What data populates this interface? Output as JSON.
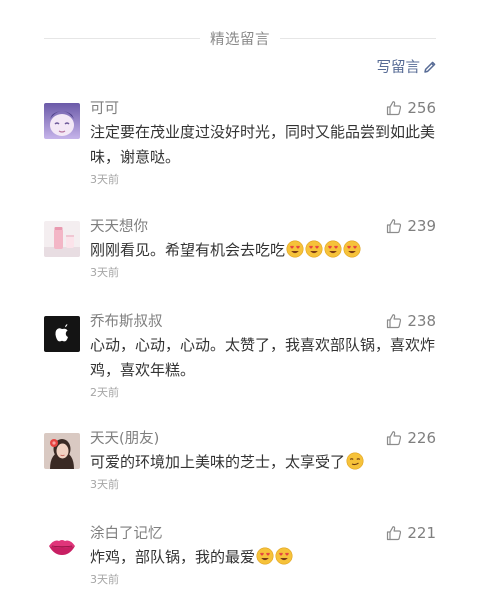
{
  "header": {
    "title": "精选留言",
    "write_label": "写留言"
  },
  "colors": {
    "link": "#576b95",
    "name": "#7f7f7f",
    "text": "#333333",
    "time": "#a5a5a5",
    "emoji_face": "#f6c23a",
    "emoji_heart": "#e64340"
  },
  "comments": [
    {
      "name": "可可",
      "likes": "256",
      "text": "注定要在茂业度过没好时光，同时又能品尝到如此美味，谢意哒。",
      "time": "3天前",
      "avatar": "anime-face-avatar",
      "emojis": []
    },
    {
      "name": "天天想你",
      "likes": "239",
      "text": "刚刚看见。希望有机会去吃吃",
      "time": "3天前",
      "avatar": "pink-cup-avatar",
      "emojis": [
        "heart-eyes-emoji",
        "heart-eyes-emoji",
        "heart-eyes-emoji",
        "heart-eyes-emoji"
      ]
    },
    {
      "name": "乔布斯叔叔",
      "likes": "238",
      "text": "心动，心动，心动。太赞了，我喜欢部队锅，喜欢炸鸡，喜欢年糕。",
      "time": "2天前",
      "avatar": "apple-logo-avatar",
      "emojis": []
    },
    {
      "name": "天天(朋友)",
      "likes": "226",
      "text": "可爱的环境加上美味的芝士，太享受了",
      "time": "3天前",
      "avatar": "girl-photo-avatar",
      "emojis": [
        "smirk-emoji"
      ]
    },
    {
      "name": "涂白了记忆",
      "likes": "221",
      "text": "炸鸡，部队锅，我的最爱",
      "time": "3天前",
      "avatar": "lips-avatar",
      "emojis": [
        "heart-eyes-emoji",
        "heart-eyes-emoji"
      ]
    }
  ]
}
